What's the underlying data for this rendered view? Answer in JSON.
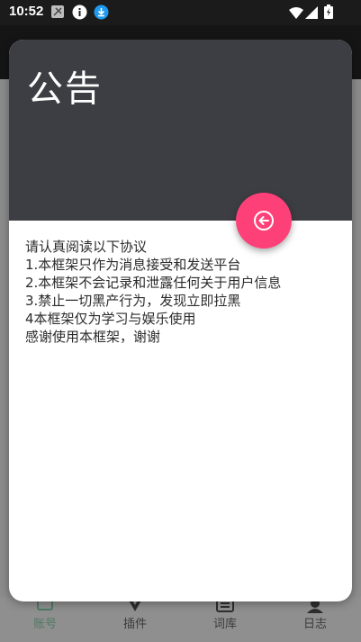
{
  "status_bar": {
    "time": "10:52"
  },
  "dialog": {
    "title": "公告",
    "lines": [
      "请认真阅读以下协议",
      "1.本框架只作为消息接受和发送平台",
      "2.本框架不会记录和泄露任何关于用户信息",
      "3.禁止一切黑产行为，发现立即拉黑",
      "4本框架仅为学习与娱乐使用",
      "感谢使用本框架，谢谢"
    ]
  },
  "bottom_nav": {
    "items": [
      {
        "label": "账号",
        "icon": "account-icon",
        "active": true
      },
      {
        "label": "插件",
        "icon": "plugin-icon",
        "active": false
      },
      {
        "label": "词库",
        "icon": "lexicon-icon",
        "active": false
      },
      {
        "label": "日志",
        "icon": "log-icon",
        "active": false
      }
    ]
  },
  "colors": {
    "header": "#3d3e44",
    "fab": "#fe4079",
    "active_tab": "#4f7a63"
  }
}
